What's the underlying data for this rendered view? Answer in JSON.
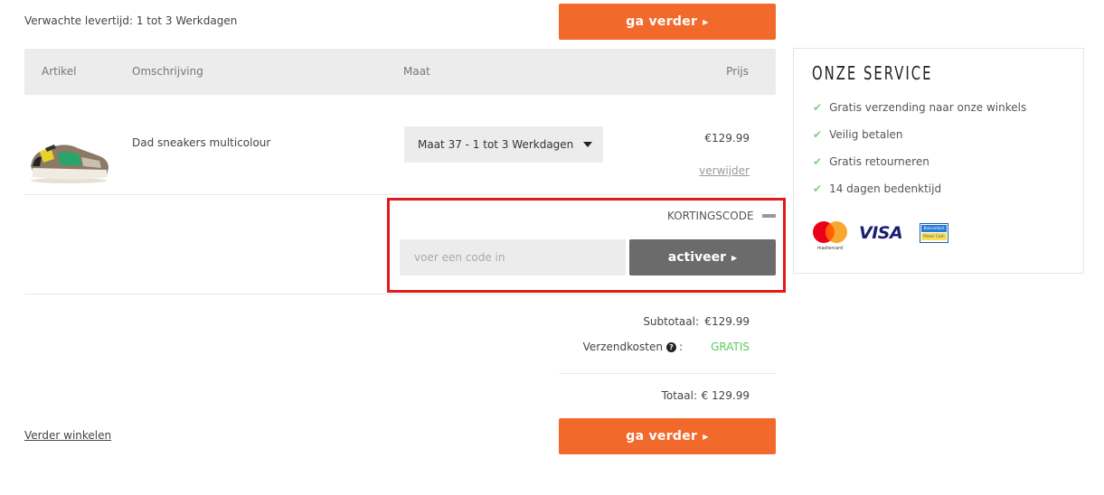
{
  "delivery": {
    "text": "Verwachte levertijd: 1 tot 3 Werkdagen"
  },
  "buttons": {
    "continue_label": "ga verder",
    "activate_label": "activeer"
  },
  "table": {
    "headers": {
      "article": "Artikel",
      "description": "Omschrijving",
      "size": "Maat",
      "price": "Prijs"
    }
  },
  "product": {
    "name": "Dad sneakers multicolour",
    "size_selected": "Maat 37 - 1 tot 3 Werkdagen",
    "price": "€129.99",
    "remove_label": "verwijder"
  },
  "discount": {
    "label": "KORTINGSCODE",
    "placeholder": "voer een code in"
  },
  "totals": {
    "subtotal_label": "Subtotaal:",
    "subtotal_value": "€129.99",
    "shipping_label": "Verzendkosten",
    "shipping_suffix": ":",
    "shipping_value": "GRATIS",
    "total_label": "Totaal:",
    "total_value": "€ 129.99"
  },
  "continue_shopping": "Verder winkelen",
  "service": {
    "title": "ONZE SERVICE",
    "items": [
      "Gratis verzending naar onze winkels",
      "Veilig betalen",
      "Gratis retourneren",
      "14 dagen bedenktijd"
    ],
    "payment": {
      "mastercard_text": "mastercard",
      "visa_text": "VISA",
      "bancontact_top": "Bancontact",
      "bancontact_bottom": "Mister Cash"
    }
  },
  "colors": {
    "accent": "#f26a2b",
    "activate_bg": "#6b6b6b",
    "free_shipping": "#5cc95c",
    "highlight": "#e01b1b"
  }
}
